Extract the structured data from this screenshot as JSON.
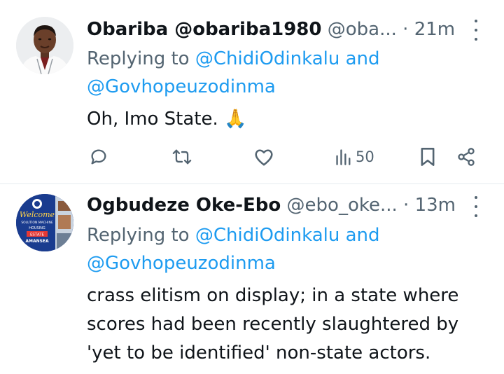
{
  "tweets": [
    {
      "name": "Obariba @obariba1980",
      "handle": "@oba...",
      "separator": "·",
      "time": "21m",
      "replying_prefix": "Replying to",
      "reply_mention_1": "@ChidiOdinkalu",
      "reply_and": "and",
      "reply_mention_2": "@Govhopeuzodinma",
      "text_lines": [
        "Oh, Imo State."
      ],
      "emoji": "🙏",
      "actions": {
        "reply_icon": "reply-icon",
        "retweet_icon": "retweet-icon",
        "like_icon": "heart-icon",
        "views_icon": "views-chart-icon",
        "views_count": "50",
        "bookmark_icon": "bookmark-icon",
        "share_icon": "share-icon"
      }
    },
    {
      "name": "Ogbudeze Oke-Ebo",
      "handle": "@ebo_oke...",
      "separator": "·",
      "time": "13m",
      "replying_prefix": "Replying to",
      "reply_mention_1": "@ChidiOdinkalu",
      "reply_and": "and",
      "reply_mention_2": "@Govhopeuzodinma",
      "text_lines": [
        "crass elitism on display; in a state where",
        "scores had been recently slaughtered by",
        "'yet to be identified' non-state actors."
      ],
      "avatar_lettering": [
        "Welcome",
        "SOLUTION MACHINE",
        "HOUSING",
        "ESTATE",
        "AMANSEA"
      ]
    }
  ],
  "colors": {
    "link": "#1d9bf0",
    "secondary": "#536471",
    "text": "#0f1419",
    "divider": "#e6ecf0"
  }
}
